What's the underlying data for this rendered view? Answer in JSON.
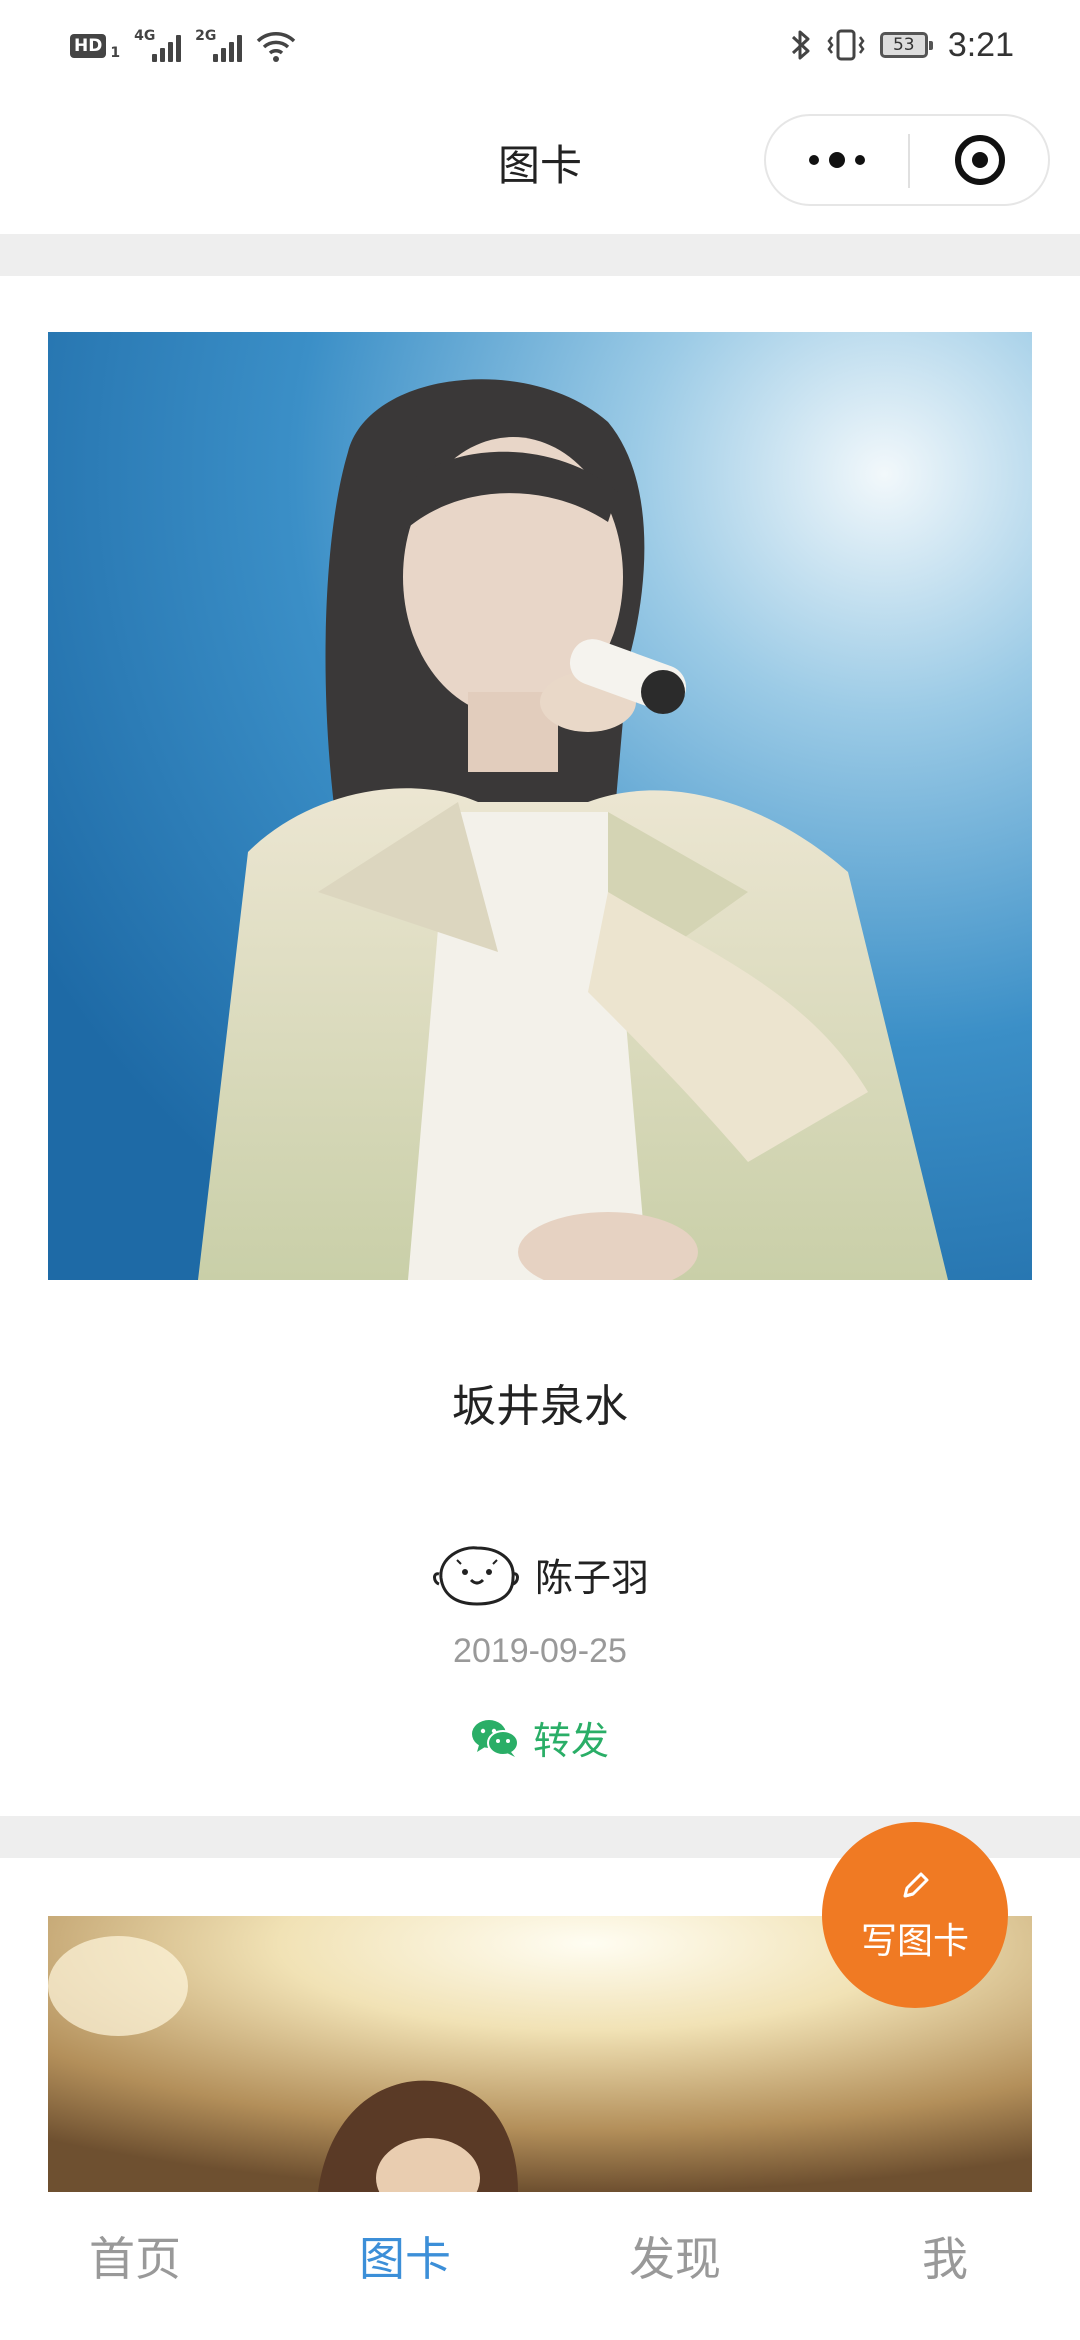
{
  "status_bar": {
    "hd": "HD",
    "hd_sub": "1",
    "net1": "4G",
    "net2": "2G",
    "battery": "53",
    "time": "3:21"
  },
  "nav": {
    "title": "图卡",
    "more_icon": "more-dots-icon",
    "close_icon": "target-close-icon"
  },
  "cards": [
    {
      "title": "坂井泉水",
      "author": "陈子羽",
      "date": "2019-09-25",
      "share_label": "转发",
      "share_icon": "wechat-icon"
    }
  ],
  "fab": {
    "label": "写图卡",
    "icon": "pencil-icon",
    "color": "#f07a23"
  },
  "tabs": [
    {
      "label": "首页",
      "active": false
    },
    {
      "label": "图卡",
      "active": true
    },
    {
      "label": "发现",
      "active": false
    },
    {
      "label": "我",
      "active": false
    }
  ],
  "colors": {
    "accent_tab": "#3c8fd8",
    "share_green": "#2aae67",
    "separator": "#eeeeee"
  }
}
